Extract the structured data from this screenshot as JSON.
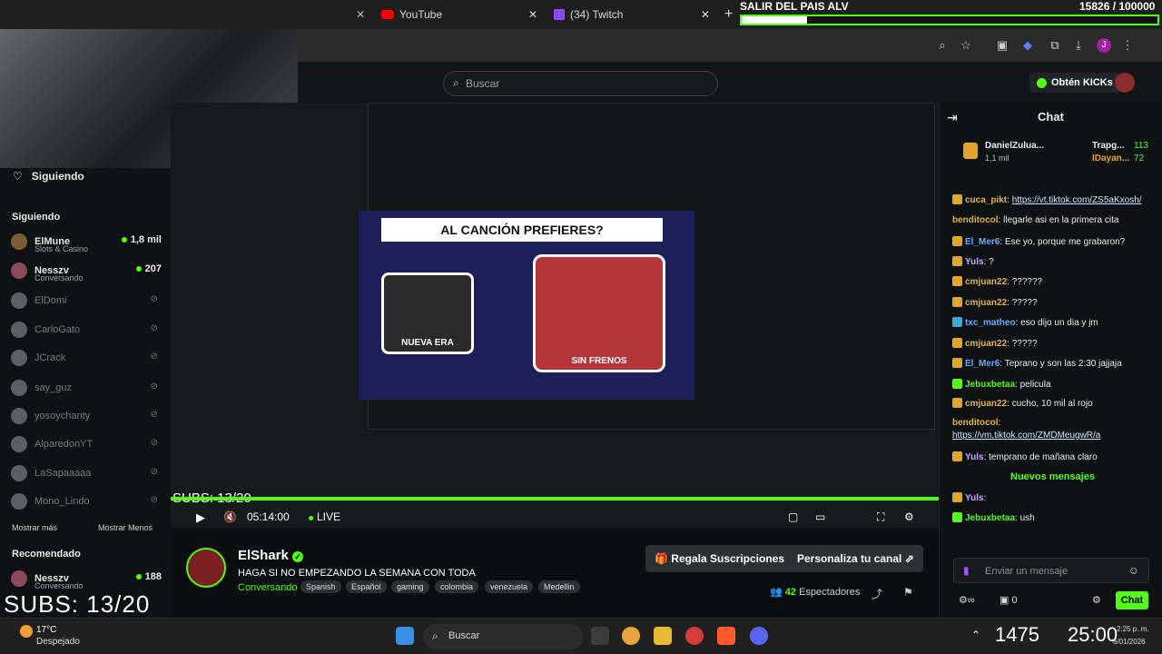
{
  "browser": {
    "tabs": [
      {
        "label": "YouTube",
        "icon": "youtube-icon"
      },
      {
        "label": "(34) Twitch",
        "icon": "twitch-icon"
      }
    ]
  },
  "goal": {
    "title": "SALIR DEL PAIS ALV",
    "count": "15826 / 100000",
    "progress": 0.158
  },
  "kick": {
    "search_placeholder": "Buscar",
    "get_kicks": "Obtén KICKs",
    "following_header": "Siguiendo"
  },
  "sidebar": {
    "section_following": "Siguiendo",
    "following": [
      {
        "name": "ElMune",
        "sub": "Slots & Casino",
        "count": "1,8 mil",
        "live": true
      },
      {
        "name": "Nesszv",
        "sub": "Conversando",
        "count": "207",
        "live": true
      },
      {
        "name": "ElDomi",
        "live": false
      },
      {
        "name": "CarloGato",
        "live": false
      },
      {
        "name": "JCrack",
        "live": false
      },
      {
        "name": "say_guz",
        "live": false
      },
      {
        "name": "yosoychanty",
        "live": false
      },
      {
        "name": "AlparedonYT",
        "live": false
      },
      {
        "name": "LaSapaaaaa",
        "live": false
      },
      {
        "name": "Mono_Lindo",
        "live": false
      }
    ],
    "show_more": "Mostrar más",
    "show_less": "Mostrar Menos",
    "section_recommended": "Recomendado",
    "recommended": [
      {
        "name": "Nesszv",
        "sub": "Conversando",
        "count": "188"
      }
    ]
  },
  "stream": {
    "banner": "AL CANCIÓN PREFIERES?",
    "card_left": "NUEVA ERA",
    "card_right": "SIN FRENOS",
    "subs_overlay": "SUBS: 13/20",
    "time": "05:14:00",
    "live": "LIVE",
    "taskbar_search": "Buscar"
  },
  "channel": {
    "name": "ElShark",
    "title": "HAGA SI NO EMPEZANDO LA SEMANA CON TODA",
    "category": "Conversando",
    "tags": [
      "Spanish",
      "Español",
      "gaming",
      "colombia",
      "venezuela",
      "Medellin"
    ],
    "gift_subs": "Regala Suscripciones",
    "customize": "Personaliza tu canal",
    "viewers": "42",
    "viewers_label": "Espectadores"
  },
  "chat": {
    "title": "Chat",
    "top_gifters": [
      {
        "name": "DanielZulua...",
        "amount": "113",
        "sub": "1,1 mil"
      },
      {
        "name": "Trapg...",
        "amount": "113"
      },
      {
        "name": "IDayan...",
        "amount": "72"
      }
    ],
    "messages": [
      {
        "user": "cuca_pikt",
        "text": "https://vt.tiktok.com/ZS5aKxosh/",
        "link": true
      },
      {
        "user": "benditocol",
        "text": "llegarle asi en la primera cita"
      },
      {
        "user": "El_Mer6",
        "text": "Ese yo, porque me grabaron?"
      },
      {
        "user": "Yuls",
        "text": "?"
      },
      {
        "user": "cmjuan22",
        "text": "??????"
      },
      {
        "user": "cmjuan22",
        "text": "?????"
      },
      {
        "user": "txc_matheo",
        "text": "eso dijo un dia y jm"
      },
      {
        "user": "cmjuan22",
        "text": "?????"
      },
      {
        "user": "El_Mer6",
        "text": "Teprano y son las 2:30 jajjaja"
      },
      {
        "user": "Jebuxbetaa",
        "text": "pelicula"
      },
      {
        "user": "cmjuan22",
        "text": "cucho, 10 mil al rojo"
      },
      {
        "user": "benditocol",
        "text": ""
      },
      {
        "user": "",
        "text": "https://vm.tiktok.com/ZMDMeugwR/a",
        "link": true
      },
      {
        "user": "Yuls",
        "text": "temprano de mañana claro"
      }
    ],
    "new_messages": "Nuevos mensajes",
    "after": [
      {
        "user": "Yuls",
        "text": ""
      },
      {
        "user": "Jebuxbetaa",
        "text": "ush"
      }
    ],
    "input_placeholder": "Enviar un mensaje",
    "points": "0",
    "send": "Chat"
  },
  "taskbar": {
    "weather_temp": "17°C",
    "weather_desc": "Despejado",
    "search": "Buscar",
    "overlay_left": "1475",
    "overlay_right": "25:00",
    "clock_time": "2:25 p. m.",
    "clock_date": "6/01/2026"
  },
  "colors": {
    "accent": "#53fc18",
    "bg": "#0b0e0f"
  }
}
